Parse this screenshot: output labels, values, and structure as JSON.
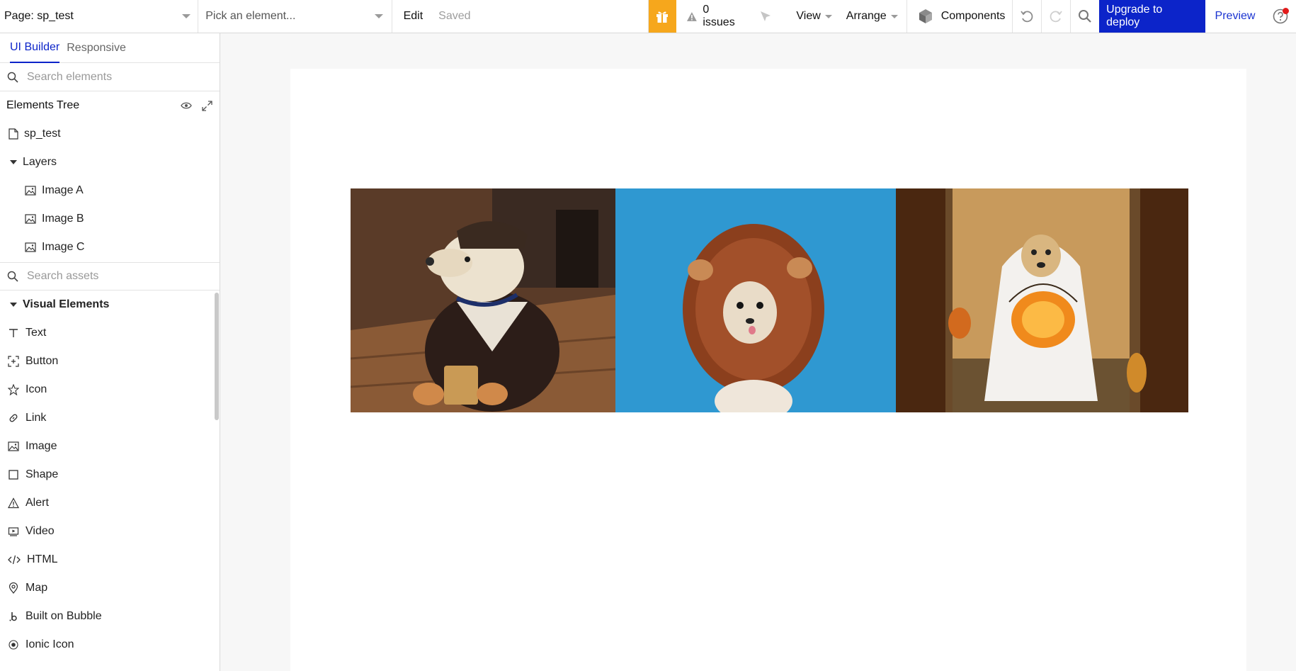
{
  "topbar": {
    "page_label": "Page: sp_test",
    "element_placeholder": "Pick an element...",
    "edit_label": "Edit",
    "saved_label": "Saved",
    "issues_label": "0 issues",
    "view_label": "View",
    "arrange_label": "Arrange",
    "components_label": "Components",
    "upgrade_label": "Upgrade to deploy",
    "preview_label": "Preview",
    "accent_color": "#0c24c9",
    "gift_color": "#f6a71c"
  },
  "sidebar": {
    "tabs": [
      {
        "label": "UI Builder",
        "active": true
      },
      {
        "label": "Responsive",
        "active": false
      }
    ],
    "search_elements_placeholder": "Search elements",
    "tree_title": "Elements Tree",
    "page_name": "sp_test",
    "layers_label": "Layers",
    "layers": [
      {
        "label": "Image A",
        "icon": "image-icon"
      },
      {
        "label": "Image B",
        "icon": "image-icon"
      },
      {
        "label": "Image C",
        "icon": "image-icon"
      }
    ],
    "search_assets_placeholder": "Search assets",
    "visual_elements_label": "Visual Elements",
    "visual_elements": [
      {
        "label": "Text",
        "icon": "text-icon"
      },
      {
        "label": "Button",
        "icon": "button-icon"
      },
      {
        "label": "Icon",
        "icon": "star-icon"
      },
      {
        "label": "Link",
        "icon": "link-icon"
      },
      {
        "label": "Image",
        "icon": "image-icon"
      },
      {
        "label": "Shape",
        "icon": "square-icon"
      },
      {
        "label": "Alert",
        "icon": "alert-icon"
      },
      {
        "label": "Video",
        "icon": "video-icon"
      },
      {
        "label": "HTML",
        "icon": "code-icon"
      },
      {
        "label": "Map",
        "icon": "map-pin-icon"
      },
      {
        "label": "Built on Bubble",
        "icon": "bubble-b-icon"
      },
      {
        "label": "Ionic Icon",
        "icon": "ionic-icon"
      }
    ]
  },
  "canvas": {
    "images": [
      {
        "name": "Image A",
        "alt": "dog-in-ups-costume"
      },
      {
        "name": "Image B",
        "alt": "chihuahua-in-lion-mane"
      },
      {
        "name": "Image C",
        "alt": "dog-in-ghost-costume-with-pumpkin"
      }
    ]
  }
}
